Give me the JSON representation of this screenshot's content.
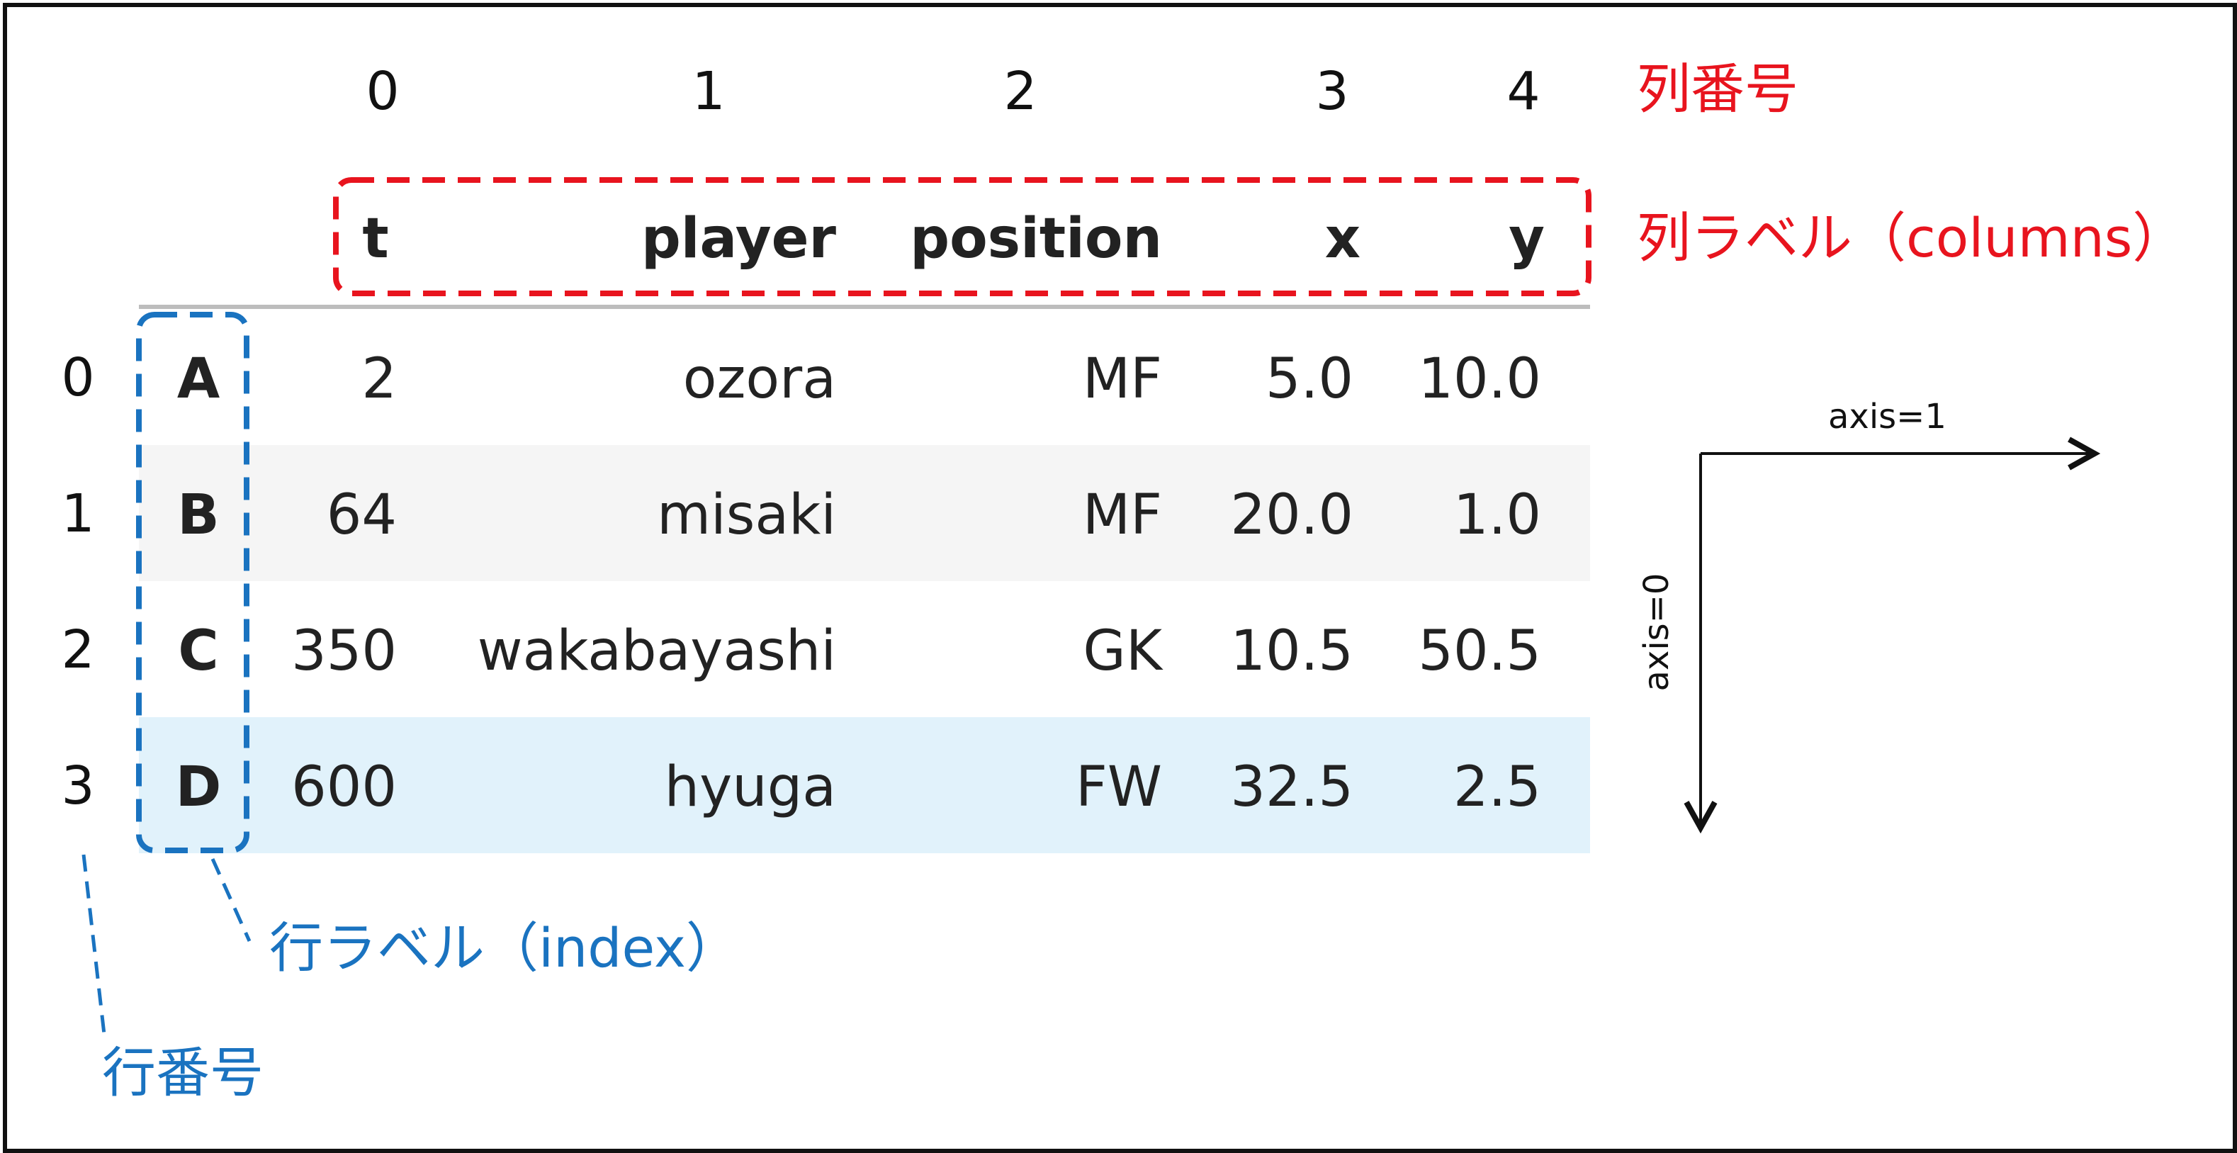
{
  "column_numbers": [
    "0",
    "1",
    "2",
    "3",
    "4"
  ],
  "column_numbers_label": "列番号",
  "column_labels_label": "列ラベル（columns）",
  "row_labels_label": "行ラベル（index）",
  "row_numbers_label": "行番号",
  "axis1_label": "axis=1",
  "axis0_label": "axis=0",
  "table": {
    "headers": [
      "t",
      "player",
      "position",
      "x",
      "y"
    ],
    "rows": [
      {
        "num": "0",
        "index": "A",
        "t": "2",
        "player": "ozora",
        "position": "MF",
        "x": "5.0",
        "y": "10.0"
      },
      {
        "num": "1",
        "index": "B",
        "t": "64",
        "player": "misaki",
        "position": "MF",
        "x": "20.0",
        "y": "1.0"
      },
      {
        "num": "2",
        "index": "C",
        "t": "350",
        "player": "wakabayashi",
        "position": "GK",
        "x": "10.5",
        "y": "50.5"
      },
      {
        "num": "3",
        "index": "D",
        "t": "600",
        "player": "hyuga",
        "position": "FW",
        "x": "32.5",
        "y": "2.5"
      }
    ]
  },
  "colors": {
    "red": "#e8141e",
    "blue": "#1a73c0",
    "stripe_gray": "#f5f5f5",
    "highlight_blue": "#e1f2fb"
  }
}
